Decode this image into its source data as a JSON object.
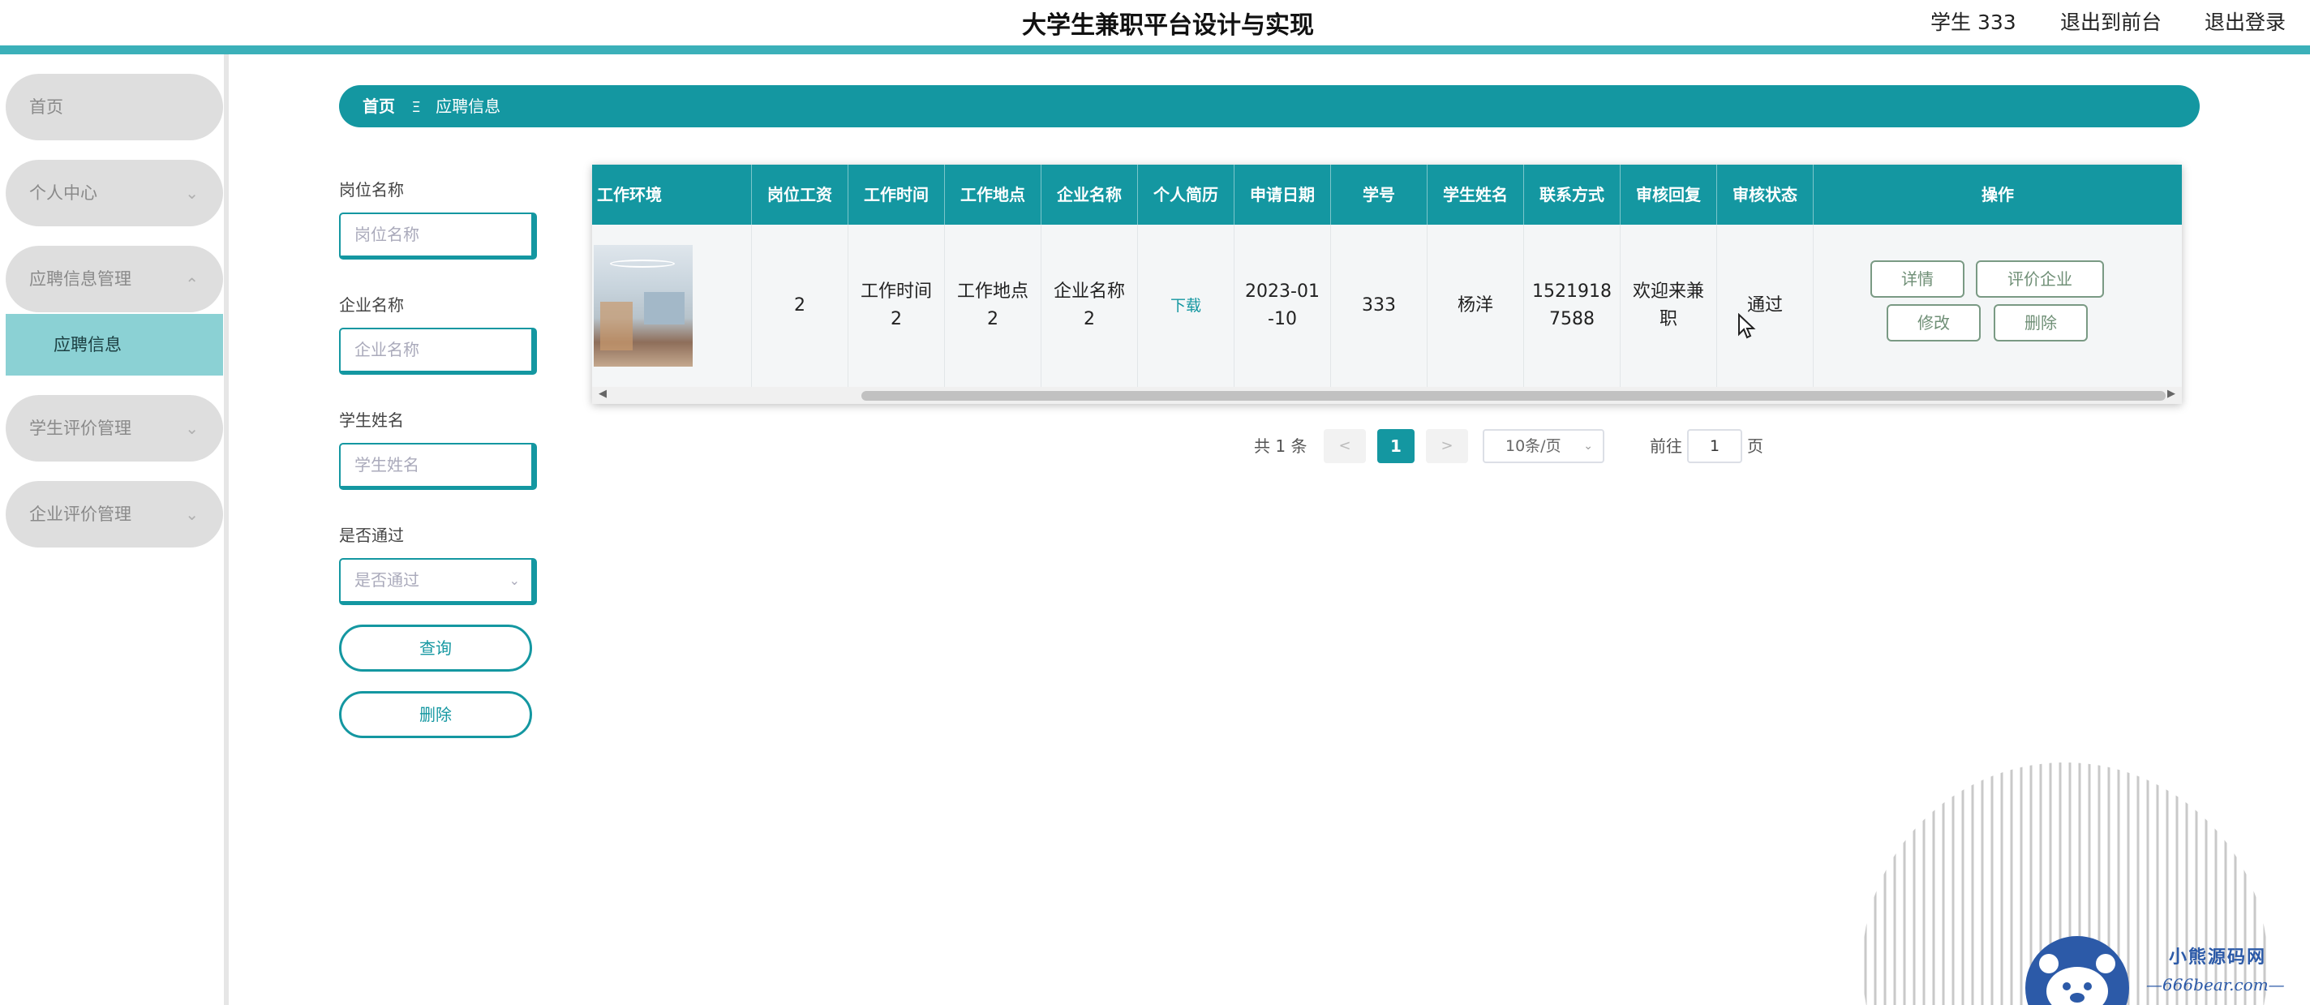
{
  "header": {
    "title": "大学生兼职平台设计与实现",
    "user": "学生 333",
    "back_front": "退出到前台",
    "logout": "退出登录"
  },
  "sidebar": {
    "items": [
      {
        "label": "首页"
      },
      {
        "label": "个人中心"
      },
      {
        "label": "应聘信息管理"
      },
      {
        "label": "学生评价管理"
      },
      {
        "label": "企业评价管理"
      }
    ],
    "active_sub": "应聘信息",
    "chevron_down": "⌄",
    "chevron_up": "⌃"
  },
  "breadcrumb": {
    "home": "首页",
    "separator": "Ξ",
    "current": "应聘信息"
  },
  "filters": {
    "job_label": "岗位名称",
    "job_placeholder": "岗位名称",
    "company_label": "企业名称",
    "company_placeholder": "企业名称",
    "student_label": "学生姓名",
    "student_placeholder": "学生姓名",
    "pass_label": "是否通过",
    "pass_placeholder": "是否通过",
    "query_button": "查询",
    "delete_button": "删除"
  },
  "table": {
    "columns": [
      "工作环境",
      "岗位工资",
      "工作时间",
      "工作地点",
      "企业名称",
      "个人简历",
      "申请日期",
      "学号",
      "学生姓名",
      "联系方式",
      "审核回复",
      "审核状态",
      "操作"
    ],
    "row": {
      "salary": "2",
      "work_time_1": "工作时间",
      "work_time_2": "2",
      "location_1": "工作地点",
      "location_2": "2",
      "company_1": "企业名称",
      "company_2": "2",
      "resume": "下载",
      "date_1": "2023-01",
      "date_2": "-10",
      "student_no": "333",
      "student_name": "杨洋",
      "phone_1": "1521918",
      "phone_2": "7588",
      "reply_1": "欢迎来兼",
      "reply_2": "职",
      "status": "通过"
    },
    "actions": {
      "detail": "详情",
      "evaluate": "评价企业",
      "edit": "修改",
      "delete": "删除"
    }
  },
  "pagination": {
    "total": "共 1 条",
    "prev": "<",
    "current": "1",
    "next": ">",
    "page_size": "10条/页",
    "goto_label": "前往",
    "goto_value": "1",
    "page_unit": "页"
  },
  "watermark": {
    "name": "小熊源码网",
    "url": "—666bear.com—"
  },
  "colors": {
    "accent": "#1497a1",
    "topbar_line": "#3bb0b9",
    "sidebar_active": "#8bd1d4"
  }
}
